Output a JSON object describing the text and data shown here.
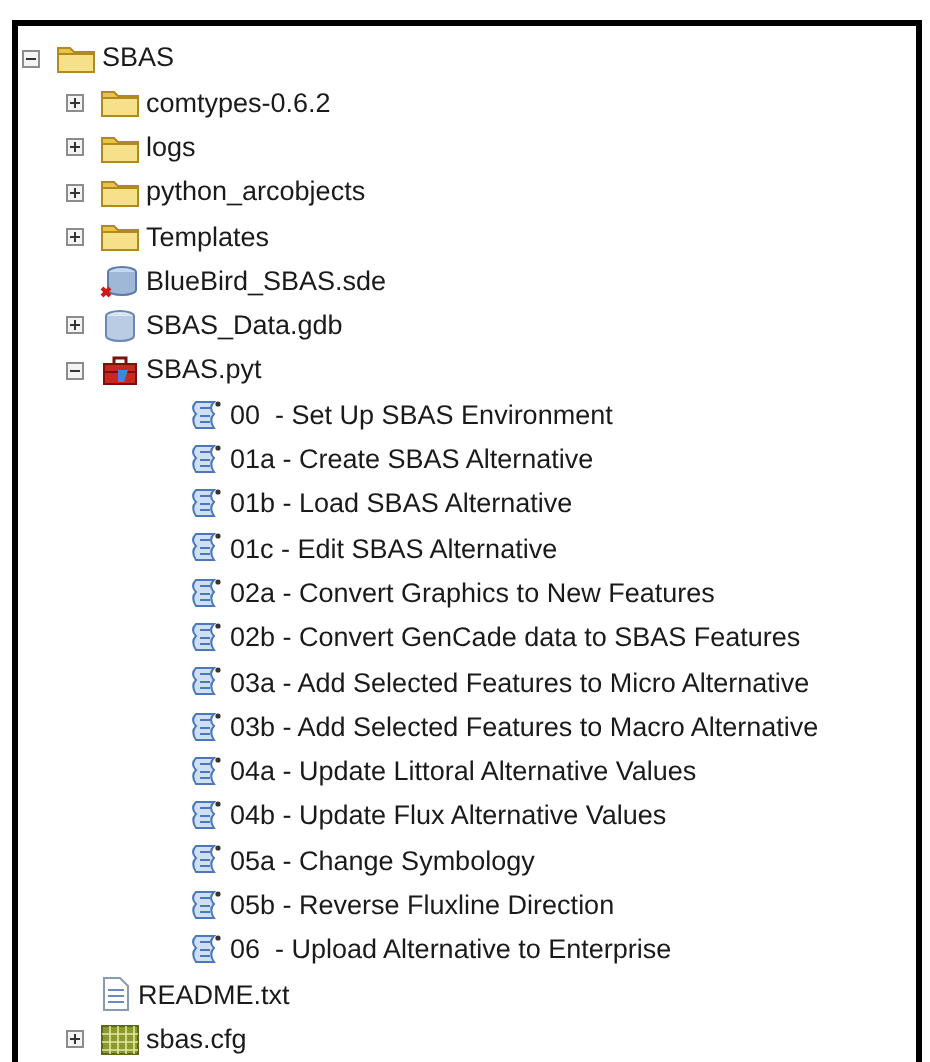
{
  "tree": [
    {
      "label": "SBAS",
      "kind": "folder",
      "expanded": true,
      "children": [
        {
          "label": "comtypes-0.6.2",
          "kind": "folder",
          "expanded": false
        },
        {
          "label": "logs",
          "kind": "folder",
          "expanded": false
        },
        {
          "label": "python_arcobjects",
          "kind": "folder",
          "expanded": false
        },
        {
          "label": "Templates",
          "kind": "folder",
          "expanded": false
        },
        {
          "label": "BlueBird_SBAS.sde",
          "kind": "sde"
        },
        {
          "label": "SBAS_Data.gdb",
          "kind": "gdb",
          "expanded": false
        },
        {
          "label": "SBAS.pyt",
          "kind": "toolbox",
          "expanded": true,
          "children": [
            {
              "label": "00  - Set Up SBAS Environment",
              "kind": "script"
            },
            {
              "label": "01a - Create SBAS Alternative",
              "kind": "script"
            },
            {
              "label": "01b - Load SBAS Alternative",
              "kind": "script"
            },
            {
              "label": "01c - Edit SBAS Alternative",
              "kind": "script"
            },
            {
              "label": "02a - Convert Graphics to New Features",
              "kind": "script"
            },
            {
              "label": "02b - Convert GenCade data to SBAS Features",
              "kind": "script"
            },
            {
              "label": "03a - Add Selected Features to Micro Alternative",
              "kind": "script"
            },
            {
              "label": "03b - Add Selected Features to Macro Alternative",
              "kind": "script"
            },
            {
              "label": "04a - Update Littoral Alternative Values",
              "kind": "script"
            },
            {
              "label": "04b - Update Flux Alternative Values",
              "kind": "script"
            },
            {
              "label": "05a - Change Symbology",
              "kind": "script"
            },
            {
              "label": "05b - Reverse Fluxline Direction",
              "kind": "script"
            },
            {
              "label": "06  - Upload Alternative to Enterprise",
              "kind": "script"
            }
          ]
        },
        {
          "label": "README.txt",
          "kind": "text"
        },
        {
          "label": "sbas.cfg",
          "kind": "cfg",
          "expanded": false
        }
      ]
    }
  ]
}
